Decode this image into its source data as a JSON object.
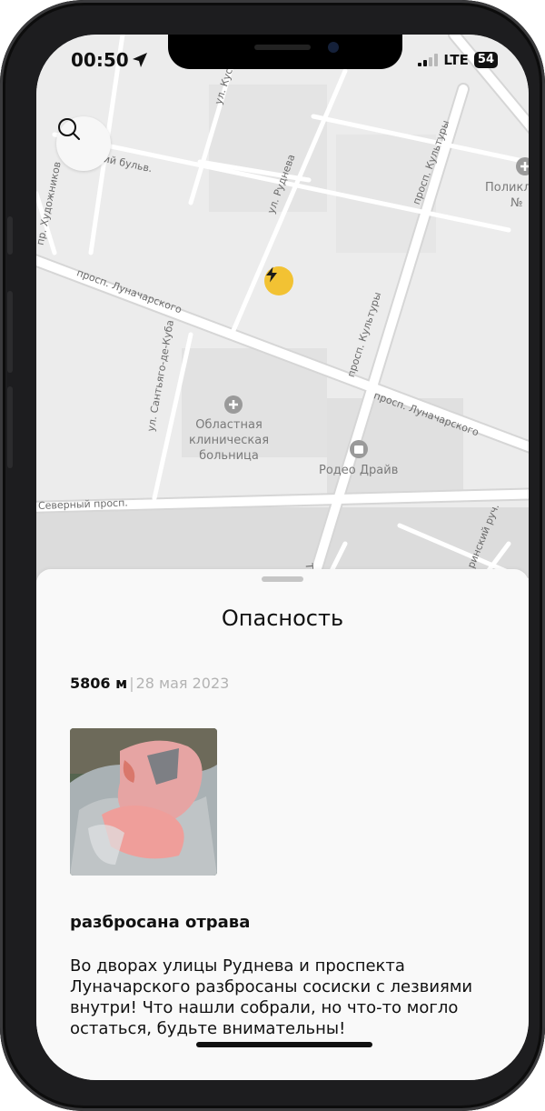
{
  "status_bar": {
    "time": "00:50",
    "network": "LTE",
    "battery": "54"
  },
  "map": {
    "streets": {
      "rudneva": "ул. Руднева",
      "kultury_1": "просп. Культуры",
      "kultury_2": "просп. Культуры",
      "lunacharskogo_1": "просп. Луначарского",
      "lunacharskogo_2": "просп. Луначарского",
      "khudozhnikov": "пр. Художников",
      "bulvar": "ий бульв.",
      "santyago": "ул. Сантьяго-де-Куба",
      "severny": "Северный просп.",
      "kus": "ул. Кус",
      "tikhor": "Тихор",
      "ruch": "ринский руч."
    },
    "pois": {
      "hospital_name": "Областная\nклиническая\nбольница",
      "mall_name": "Родео Драйв",
      "clinic_line1": "Поликл",
      "clinic_line2": "№"
    },
    "hazard_icon": "lightning-icon",
    "colors": {
      "hazard_pin": "#f2c233",
      "map_bg": "#ececec"
    }
  },
  "sheet": {
    "title": "Опасность",
    "distance": "5806 м",
    "separator": "|",
    "date": "28 мая 2023",
    "item_title": "разбросана отрава",
    "item_description": "Во дворах улицы Руднева и проспекта Луначарского разбросаны сосиски с лезвиями внутри! Что нашли собрали, но что-то могло остаться, будьте внимательны!"
  }
}
